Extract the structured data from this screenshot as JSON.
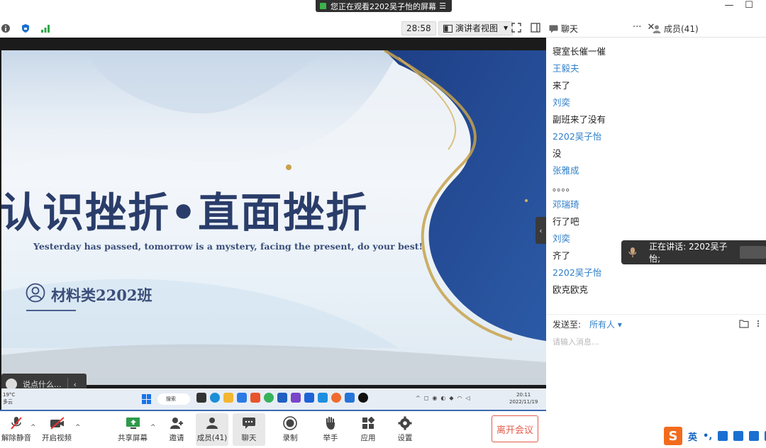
{
  "share_banner": {
    "text": "您正在观看2202吴子怡的屏幕",
    "menu_icon": "list-icon"
  },
  "toolbar": {
    "timer": "28:58",
    "view_mode": "演讲者视图",
    "icons": [
      "info-icon",
      "shield-icon",
      "signal-icon",
      "fullscreen-icon",
      "sidebar-icon"
    ]
  },
  "slide": {
    "title": "认识挫折•直面挫折",
    "subtitle": "Yesterday has passed, tomorrow is a mystery, facing the present, do your best!",
    "class_name": "材料类2202班"
  },
  "floating_chat": {
    "placeholder": "说点什么..."
  },
  "win_taskbar": {
    "weather_temp": "19°C",
    "weather_desc": "多云",
    "search": "搜索",
    "clock_time": "20:11",
    "clock_date": "2022/11/19"
  },
  "panel": {
    "tab_chat": "聊天",
    "tab_more": "···",
    "tab_close": "✕",
    "tab_members": "成员(41)"
  },
  "messages": [
    {
      "kind": "text",
      "content": "寝室长催一催"
    },
    {
      "kind": "sender",
      "content": "王毅夫"
    },
    {
      "kind": "text",
      "content": "来了"
    },
    {
      "kind": "sender",
      "content": "刘奕"
    },
    {
      "kind": "text",
      "content": "副班来了没有"
    },
    {
      "kind": "sender",
      "content": "2202吴子怡"
    },
    {
      "kind": "text",
      "content": "没"
    },
    {
      "kind": "sender",
      "content": "张雅成"
    },
    {
      "kind": "text",
      "content": "。。。。"
    },
    {
      "kind": "sender",
      "content": "邓瑞琦"
    },
    {
      "kind": "text",
      "content": "行了吧"
    },
    {
      "kind": "sender",
      "content": "刘奕"
    },
    {
      "kind": "text",
      "content": "齐了"
    },
    {
      "kind": "sender",
      "content": "2202吴子怡"
    },
    {
      "kind": "text",
      "content": "欧克欧克"
    }
  ],
  "speaking": {
    "text": "正在讲话: 2202吴子怡;"
  },
  "send": {
    "label": "发送至:",
    "target": "所有人 ▾",
    "placeholder": "请输入消息..."
  },
  "bottom_bar": {
    "mute": "解除静音",
    "video": "开启视频",
    "share": "共享屏幕",
    "invite": "邀请",
    "members": "成员(41)",
    "chat": "聊天",
    "record": "录制",
    "raise_hand": "举手",
    "apps": "应用",
    "settings": "设置",
    "leave": "离开会议"
  },
  "ime": {
    "logo": "S",
    "lang": "英",
    "punct": "•,",
    "icons": [
      "mic-icon",
      "keyboard-icon",
      "shirt-icon",
      "grid-icon"
    ]
  },
  "colors": {
    "accent_blue": "#2f7fc8",
    "leave_red": "#e35a4a",
    "slide_ink": "#2a3d6a"
  }
}
